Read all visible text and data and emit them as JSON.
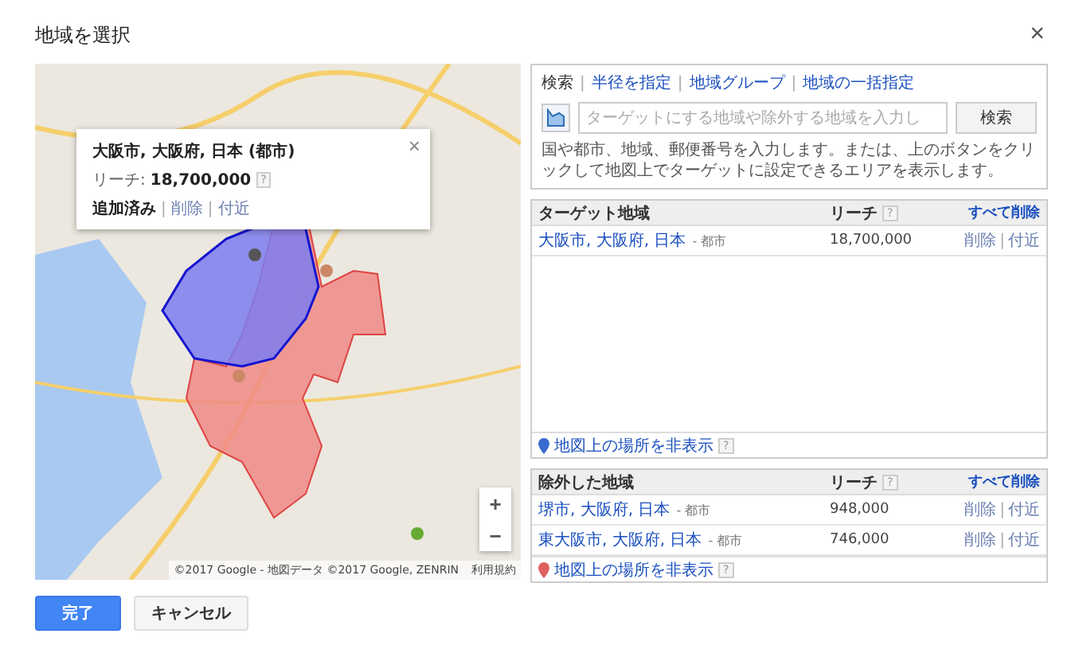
{
  "dialog": {
    "title": "地域を選択",
    "close": "×"
  },
  "map": {
    "popup": {
      "title": "大阪市, 大阪府, 日本 (都市)",
      "reach_label": "リーチ:",
      "reach_value": "18,700,000",
      "help": "?",
      "status": "追加済み",
      "actions": [
        {
          "separator": "|",
          "label": "削除"
        },
        {
          "separator": "|",
          "label": "付近"
        }
      ],
      "close": "×"
    },
    "zoom_in": "+",
    "zoom_out": "−",
    "attribution": "©2017 Google - 地図データ ©2017 Google, ZENRIN",
    "terms": "利用規約"
  },
  "search": {
    "tabs": [
      {
        "label": "検索",
        "selected": true
      },
      {
        "separator": "|",
        "label": "半径を指定",
        "selected": false
      },
      {
        "separator": "|",
        "label": "地域グループ",
        "selected": false
      },
      {
        "separator": "|",
        "label": "地域の一括指定",
        "selected": false
      }
    ],
    "placeholder": "ターゲットにする地域や除外する地域を入力し",
    "button": "検索",
    "hint": "国や都市、地域、郵便番号を入力します。または、上のボタンをクリックして地図上でターゲットに設定できるエリアを表示します。"
  },
  "targeted": {
    "heading": "ターゲット地域",
    "reach_heading": "リーチ",
    "help": "?",
    "remove_all": "すべて削除",
    "rows": [
      {
        "name": "大阪市, 大阪府, 日本",
        "type": "- 都市",
        "reach": "18,700,000",
        "actions": [
          "削除",
          "付近"
        ],
        "separator": "|"
      }
    ],
    "footer": "地図上の場所を非表示",
    "footer_help": "?"
  },
  "excluded": {
    "heading": "除外した地域",
    "reach_heading": "リーチ",
    "help": "?",
    "remove_all": "すべて削除",
    "rows": [
      {
        "name": "堺市, 大阪府, 日本",
        "type": "- 都市",
        "reach": "948,000",
        "actions": [
          "削除",
          "付近"
        ],
        "separator": "|"
      },
      {
        "name": "東大阪市, 大阪府, 日本",
        "type": "- 都市",
        "reach": "746,000",
        "actions": [
          "削除",
          "付近"
        ],
        "separator": "|"
      }
    ],
    "footer": "地図上の場所を非表示",
    "footer_help": "?"
  },
  "buttons": [
    {
      "label": "完了",
      "kind": "primary"
    },
    {
      "label": "キャンセル",
      "kind": "secondary"
    }
  ]
}
